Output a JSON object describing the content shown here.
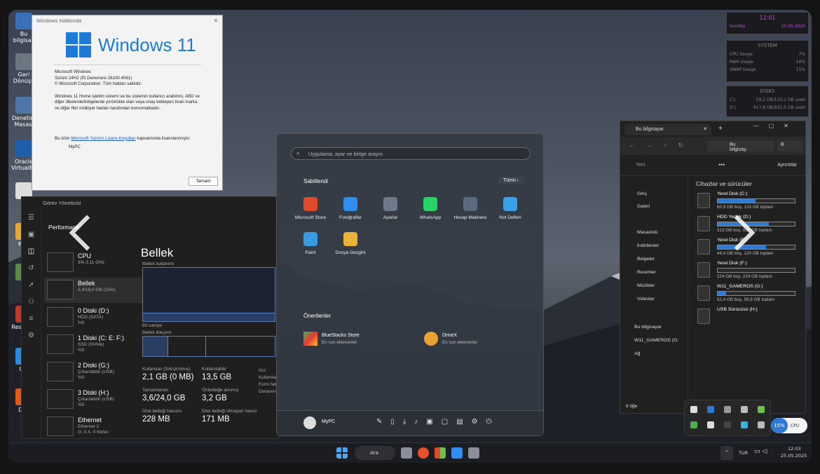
{
  "desktop": {
    "icons": [
      {
        "label": "Bu bilgisay",
        "color": "#3b6fb8"
      },
      {
        "label": "Geri Dönüşü",
        "color": "#6b7680"
      },
      {
        "label": "Denetim Masası",
        "color": "#4f76a8"
      },
      {
        "label": "Oracle VirtualBo",
        "color": "#1d5fa8"
      },
      {
        "label": "7z",
        "color": "#ddd"
      },
      {
        "label": "Pow",
        "color": "#e8a735"
      },
      {
        "label": "N",
        "color": "#5d8b43"
      },
      {
        "label": "Rest 201",
        "color": "#c0392b"
      },
      {
        "label": "Uni",
        "color": "#2b8be0"
      },
      {
        "label": "Dov",
        "color": "#e25a1c"
      }
    ]
  },
  "about": {
    "title": "Windows Hakkında",
    "brand": "Windows 11",
    "lines": [
      "Microsoft Windows",
      "Sürüm 24H2 (İS Derlemesi 26100.4061)",
      "© Microsoft Corporation. Tüm hakları saklıdır."
    ],
    "legal": "Windows 11 Home işletim sistemi ve bu sistemin kullanıcı arabirimi, ABD ve diğer ülkelerde/bölgelerde yürürlükte olan veya onay bekleyen ticari marka ve diğer fikri mülkiyet hakları tarafından korunmaktadır.",
    "license_prefix": "Bu ürün",
    "license_link": "Microsoft Yazılım Lisans Koşulları",
    "license_suffix": "kapsamında lisanslanmıştır:",
    "user": "MyPC",
    "ok": "Tamam"
  },
  "taskmanager": {
    "title": "Görev Yöneticisi",
    "section": "Performans",
    "heading": "Bellek",
    "items": [
      {
        "name": "CPU",
        "detail": "3% 3.11 GHz"
      },
      {
        "name": "Bellek",
        "detail": "2,4/16,0 GB (15%)"
      },
      {
        "name": "0 Diski (D:)",
        "detail": "HDD (SATA)\n%0"
      },
      {
        "name": "1 Diski (C: E: F:)",
        "detail": "SSD (NVMe)\n%0"
      },
      {
        "name": "2 Diski (G:)",
        "detail": "Çıkarılabilir (USB)\n%0"
      },
      {
        "name": "3 Diski (H:)",
        "detail": "Çıkarılabilir (USB)\n%0"
      },
      {
        "name": "Ethernet",
        "detail": "Ethernet 2\nG: 0 A: 0 Kb/sn"
      },
      {
        "name": "Ethernet",
        "detail": ""
      }
    ],
    "usage_label": "Bellek kullanımı",
    "seconds": "60 saniye",
    "composition_label": "Bellek bileşimi",
    "stats": [
      {
        "label": "Kullanılan (Sıkıştırılmış)",
        "value": "2,1 GB (0 MB)"
      },
      {
        "label": "Kullanılabilir",
        "value": "13,5 GB"
      },
      {
        "label": "Tamamlanan",
        "value": "3,6/24,0 GB"
      },
      {
        "label": "Önbelleğe alınmış",
        "value": "3,2 GB"
      },
      {
        "label": "Disk belleği havuzu",
        "value": "228 MB"
      },
      {
        "label": "Disk belleği olmayan havuz",
        "value": "171 MB"
      }
    ],
    "right_labels": [
      "Hız:",
      "Kullanıla",
      "Form fak",
      "Donanım"
    ]
  },
  "start": {
    "search_placeholder": "Uygulama, ayar ve belge arayın",
    "pinned": "Sabitlendi",
    "all": "Tümü",
    "apps": [
      {
        "label": "Microsoft Store",
        "color": "#e04a2b"
      },
      {
        "label": "Fotoğraflar",
        "color": "#2f8ef0"
      },
      {
        "label": "Ayarlar",
        "color": "#6e7a8a"
      },
      {
        "label": "WhatsApp",
        "color": "#25d366"
      },
      {
        "label": "Hesap Makinesi",
        "color": "#5a6a80"
      },
      {
        "label": "Not Defteri",
        "color": "#3aa0e8"
      },
      {
        "label": "Paint",
        "color": "#3a9be0"
      },
      {
        "label": "Dosya Gezgini",
        "color": "#e8b53a"
      }
    ],
    "recommended": "Önerilenler",
    "rec": [
      {
        "name": "BlueStacks Store",
        "sub": "En son eklenenler"
      },
      {
        "name": "DriveX",
        "sub": "En son eklenenler"
      }
    ],
    "user": "MyPC"
  },
  "explorer": {
    "tab": "Bu bilgisayar",
    "address": "Bu bilgisay.",
    "search": "B",
    "new": "Yeni",
    "details": "Ayrıntılar",
    "nav": [
      "Giriş",
      "Galeri",
      "Masaüstü",
      "İndirilenler",
      "Belgeler",
      "Resimler",
      "Müzikler",
      "Videolar",
      "Bu bilgisayar",
      "W11_GAMEROS (G:",
      "Ağ"
    ],
    "group": "Cihazlar ve sürücüler",
    "drives": [
      {
        "name": "Yerel Disk (C:)",
        "space": "60,9 GB boş, 120 GB toplam",
        "used": 0.49
      },
      {
        "name": "HDD Yedek (D:)",
        "space": "313 GB boş, 931 GB toplam",
        "used": 0.66
      },
      {
        "name": "Yerel Disk (E:)",
        "space": "44,4 GB boş, 120 GB toplam",
        "used": 0.63
      },
      {
        "name": "Yerel Disk (F:)",
        "space": "224 GB boş, 224 GB toplam",
        "used": 0.0
      },
      {
        "name": "W11_GAMEROS (G:)",
        "space": "52,4 GB boş, 58,9 GB toplam",
        "used": 0.11
      },
      {
        "name": "USB Sürücüsü (H:)",
        "space": "",
        "used": null
      }
    ],
    "count": "6 öğe"
  },
  "widgets": {
    "time": "12:01",
    "day": "Sunday",
    "date": "25.05.2025",
    "system": "SYSTEM",
    "cpu_label": "CPU Usage",
    "cpu": "7%",
    "ram_label": "RAM Usage",
    "ram": "16%",
    "swap_label": "SWAP Usage",
    "swap": "15%",
    "disks": "DISKS",
    "c_label": "C:\\",
    "c_val": "59,2 GB/120,1 GB used",
    "d_label": "D:\\",
    "d_val": "617,8 GB/931,5 GB used"
  },
  "taskbar": {
    "search": "Ara",
    "lang": "TUR",
    "time": "12:03",
    "date": "25.05.2025",
    "cpu_pct": "15%",
    "cpu_label": "CPU"
  }
}
